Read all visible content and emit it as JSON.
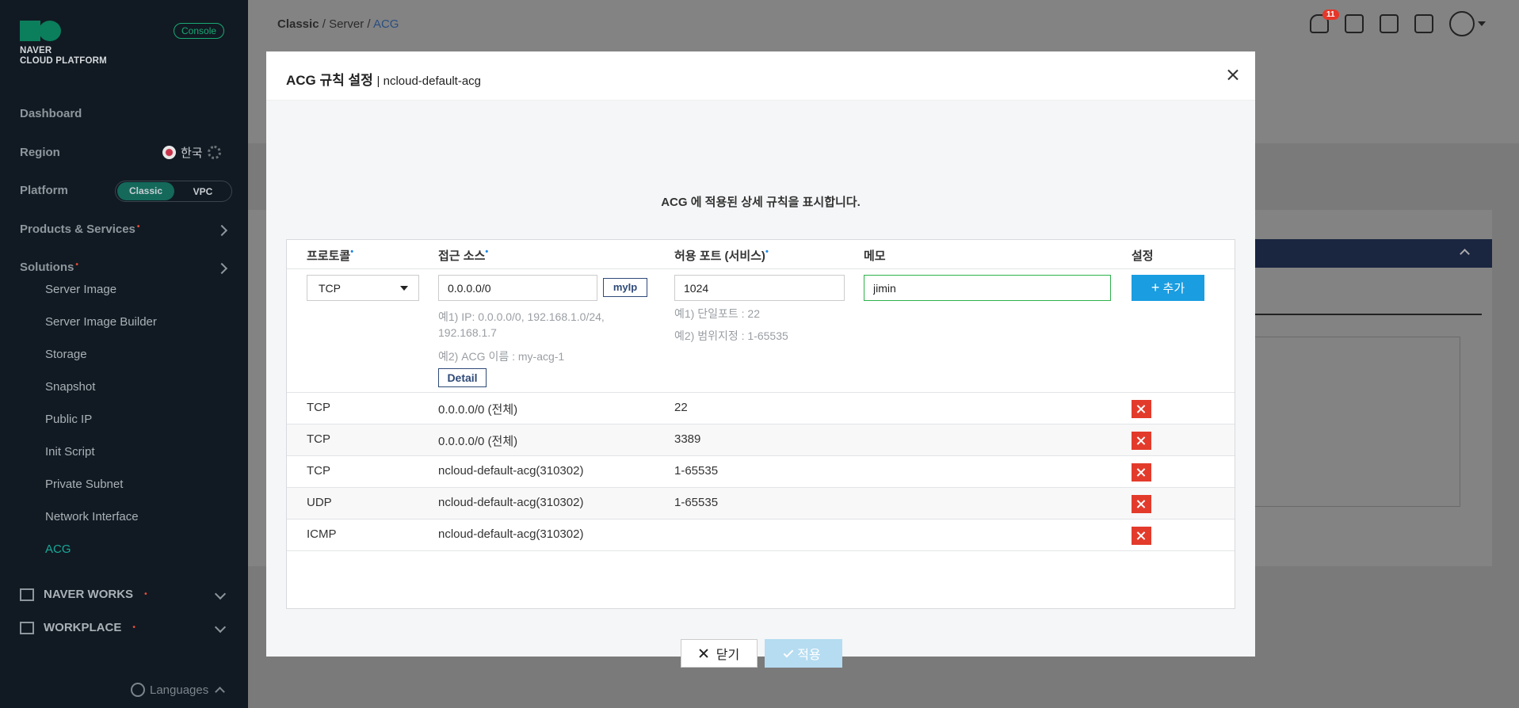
{
  "sidebar": {
    "logo_line1": "NAVER",
    "logo_line2": "CLOUD PLATFORM",
    "console_badge": "Console",
    "dashboard": "Dashboard",
    "region_label": "Region",
    "region_value": "한국",
    "platform_label": "Platform",
    "platform_options": [
      "Classic",
      "VPC"
    ],
    "products_label": "Products & Services",
    "solutions_label": "Solutions",
    "sub_items": [
      "Server Image",
      "Server Image Builder",
      "Storage",
      "Snapshot",
      "Public IP",
      "Init Script",
      "Private Subnet",
      "Network Interface",
      "ACG"
    ],
    "naver_works": "NAVER WORKS",
    "workplace": "WORKPLACE",
    "languages": "Languages",
    "new_marker": "•"
  },
  "breadcrumb": [
    "Classic",
    "Server",
    "ACG"
  ],
  "notifications_count": "11",
  "modal": {
    "title": "ACG 규칙 설정",
    "subtitle": "| ncloud-default-acg",
    "description": "ACG 에 적용된 상세 규칙을 표시합니다.",
    "columns": {
      "protocol": "프로토콜",
      "source": "접근 소스",
      "port": "허용 포트 (서비스)",
      "memo": "메모",
      "settings": "설정"
    },
    "required_marker": "•",
    "form": {
      "protocol": "TCP",
      "source": "0.0.0.0/0",
      "myip_label": "myIp",
      "port": "1024",
      "memo": "jimin",
      "add_label": "추가",
      "source_hint1": "예1) IP: 0.0.0.0/0, 192.168.1.0/24,",
      "source_hint2": "192.168.1.7",
      "source_hint3": "예2) ACG 이름 : my-acg-1",
      "detail_label": "Detail",
      "port_hint1": "예1) 단일포트 : 22",
      "port_hint2": "예2) 범위지정 : 1-65535"
    },
    "rules": [
      {
        "protocol": "TCP",
        "source": "0.0.0.0/0 (전체)",
        "port": "22"
      },
      {
        "protocol": "TCP",
        "source": "0.0.0.0/0 (전체)",
        "port": "3389"
      },
      {
        "protocol": "TCP",
        "source": "ncloud-default-acg(310302)",
        "port": "1-65535"
      },
      {
        "protocol": "UDP",
        "source": "ncloud-default-acg(310302)",
        "port": "1-65535"
      },
      {
        "protocol": "ICMP",
        "source": "ncloud-default-acg(310302)",
        "port": ""
      }
    ],
    "close_label": "닫기",
    "apply_label": "적용"
  },
  "colors": {
    "accent": "#1a9de1",
    "brand": "#0b7e5c",
    "delete": "#e33b2b"
  }
}
